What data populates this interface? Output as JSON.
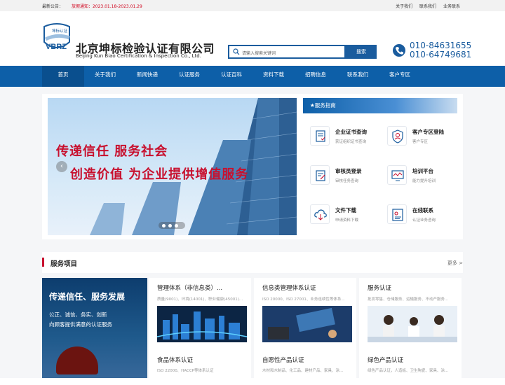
{
  "topbar": {
    "notice_label": "最新公告：",
    "notice_text": "放假通知：2023.01.18-2023.01.29",
    "links": [
      "关于我们",
      "联系我们",
      "业务联系"
    ]
  },
  "brand": {
    "logo_text": "VBRZ",
    "logo_sub": "坤标认证",
    "name_cn": "北京坤标检验认证有限公司",
    "name_en": "Beijing Kun Biao Certification & Inspection Co., Ltd."
  },
  "search": {
    "placeholder": "请输入搜索关键词",
    "button": "搜索"
  },
  "phones": [
    "010-84631655",
    "010-64749681"
  ],
  "nav": [
    "首页",
    "关于我们",
    "新闻快递",
    "认证服务",
    "认证百科",
    "资料下载",
    "招聘信息",
    "联系我们",
    "客户专区"
  ],
  "banner": {
    "line1": "传递信任 服务社会",
    "line2": "创造价值 为企业提供增值服务"
  },
  "guide": {
    "title": "★服务指南",
    "items": [
      {
        "title": "企业证书查询",
        "sub": "获证组织证书查询"
      },
      {
        "title": "客户专区登陆",
        "sub": "客户专区"
      },
      {
        "title": "审核员登录",
        "sub": "审核任务查询"
      },
      {
        "title": "培训平台",
        "sub": "能力提升培训"
      },
      {
        "title": "文件下载",
        "sub": "申请资料下载"
      },
      {
        "title": "在线联系",
        "sub": "认证业务咨询"
      }
    ]
  },
  "section": {
    "title": "服务项目",
    "more": "更多 >"
  },
  "promo": {
    "line1": "传递信任、服务发展",
    "line2": "公正、诚信、务实、创新",
    "line3": "向顾客提供满意的认证服务"
  },
  "services": [
    {
      "title": "管理体系（非信息类）...",
      "sub": "质量(9001)、环境(14001)、职业健康(45001)..."
    },
    {
      "title": "信息类管理体系认证",
      "sub": "ISO 20000、ISO 27001、业务连续性等体系..."
    },
    {
      "title": "服务认证",
      "sub": "批发零售、仓储服务、运输服务、不动产服务..."
    },
    {
      "title": "食品体系认证",
      "sub": "ISO 22000、HACCP等体系认证"
    },
    {
      "title": "自愿性产品认证",
      "sub": "木材和木制品、化工品、建材产品、家具、涂..."
    },
    {
      "title": "绿色产品认证",
      "sub": "绿色产品认证，人造板、卫生陶瓷、家具、涂..."
    }
  ],
  "colors": {
    "primary": "#0d5fa8",
    "accent": "#c8102e"
  }
}
